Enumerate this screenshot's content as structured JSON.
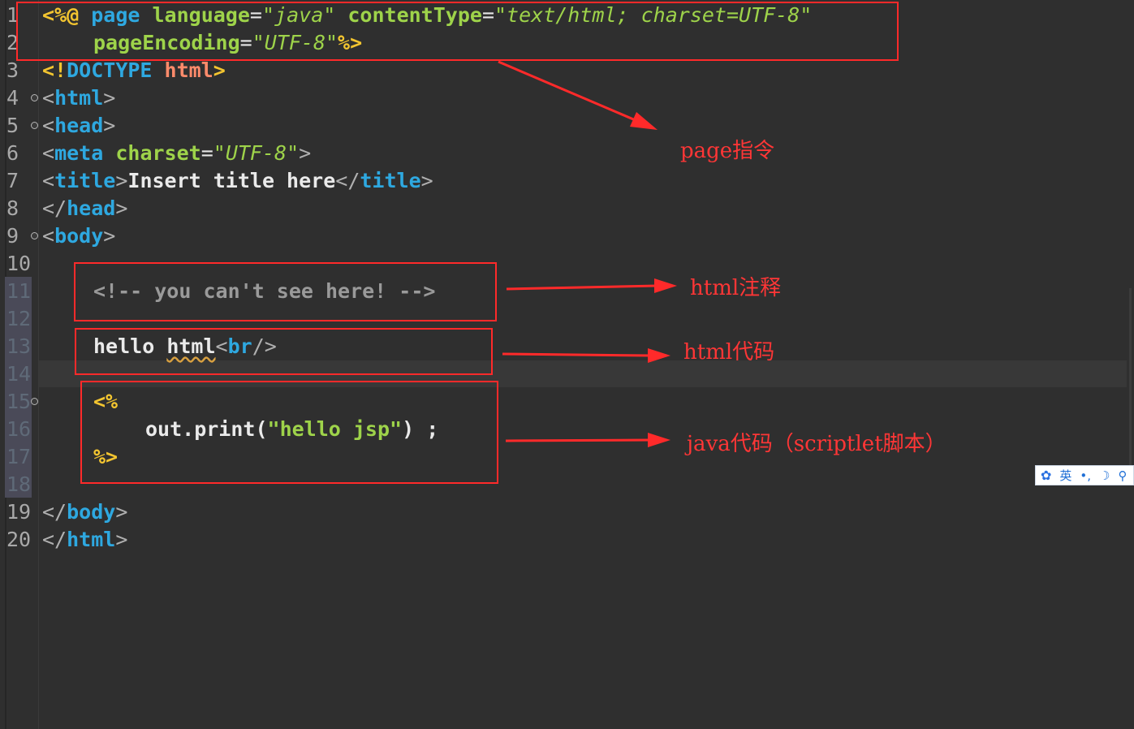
{
  "editor": {
    "line_numbers": [
      "1",
      "2",
      "3",
      "4",
      "5",
      "6",
      "7",
      "8",
      "9",
      "10",
      "11",
      "12",
      "13",
      "14",
      "15",
      "16",
      "17",
      "18",
      "19",
      "20"
    ],
    "lines": {
      "l1": {
        "dir_open": "<%@",
        "page": "page",
        "lang_attr": "language",
        "eq": "=",
        "lang_val": "\"java\"",
        "ct_attr": "contentType",
        "ct_val": "\"text/html; charset=UTF-8\""
      },
      "l2": {
        "pe_attr": "pageEncoding",
        "pe_val": "\"UTF-8\"",
        "dir_close": "%>"
      },
      "l3": {
        "open": "<!",
        "doctype": "DOCTYPE",
        "html": "html",
        "close": ">"
      },
      "l4": {
        "open": "<",
        "tag": "html",
        "close": ">"
      },
      "l5": {
        "open": "<",
        "tag": "head",
        "close": ">"
      },
      "l6": {
        "open": "<",
        "tag": "meta",
        "attr": "charset",
        "eq": "=",
        "val": "\"UTF-8\"",
        "close": ">"
      },
      "l7": {
        "open": "<",
        "tag": "title",
        "gt": ">",
        "text": "Insert title here",
        "endopen": "</",
        "endtag": "title",
        "close": ">"
      },
      "l8": {
        "open": "</",
        "tag": "head",
        "close": ">"
      },
      "l9": {
        "open": "<",
        "tag": "body",
        "close": ">"
      },
      "l11": {
        "comment": "<!-- you can't see here! -->"
      },
      "l13": {
        "text": "hello ",
        "word": "html",
        "open": "<",
        "tag": "br",
        "close": "/>"
      },
      "l15": {
        "scriptlet_open": "<%"
      },
      "l16": {
        "pre": "out.print(",
        "str": "\"hello jsp\"",
        "post": ") ;"
      },
      "l17": {
        "scriptlet_close": "%>"
      },
      "l19": {
        "open": "</",
        "tag": "body",
        "close": ">"
      },
      "l20": {
        "open": "</",
        "tag": "html",
        "close": ">"
      }
    }
  },
  "annotations": {
    "page_directive": "page指令",
    "html_comment": "html注释",
    "html_code": "html代码",
    "java_code": "java代码（scriptlet脚本）"
  },
  "ime_toolbar": {
    "icon": "paw-icon",
    "mode": "英",
    "punct": "•,",
    "moon": "☽",
    "extra": "⚲"
  },
  "colors": {
    "background": "#2f2f2f",
    "annotation_red": "#ff2a2a",
    "tag_blue": "#2ea8e0",
    "attr_green": "#9ed34a",
    "directive_yellow": "#f3c530"
  }
}
